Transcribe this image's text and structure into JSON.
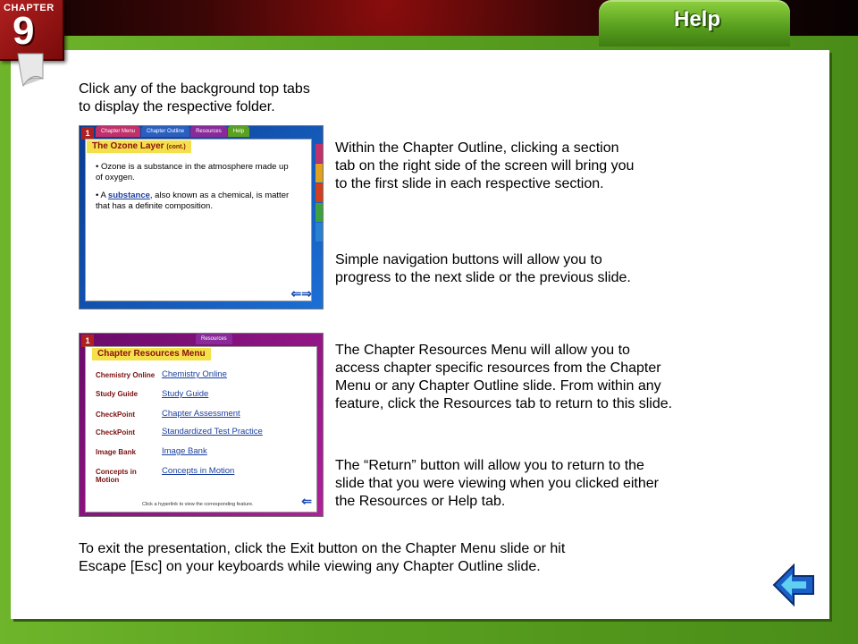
{
  "header": {
    "chapter_label": "CHAPTER",
    "chapter_number": "9",
    "active_tab": "Help"
  },
  "content": {
    "intro_text": "Click any of the background top tabs\nto display the respective folder.",
    "outline_text": "Within the Chapter Outline, clicking a section\ntab on the right side of the screen will bring you\nto the first slide in each respective section.",
    "nav_text": "Simple navigation buttons will allow you to\nprogress to the next slide or the previous slide.",
    "resources_text": "The Chapter Resources Menu will allow you to\naccess chapter specific resources from the Chapter\nMenu or any Chapter Outline slide. From within any\nfeature, click the Resources tab to return to this slide.",
    "return_text": "The “Return” button will allow you to return to the\nslide that you were viewing when you clicked either\nthe Resources or Help tab.",
    "exit_text": "To exit the presentation, click the Exit button on the Chapter Menu slide or hit\nEscape [Esc] on your keyboards while viewing any Chapter Outline slide."
  },
  "thumb_outline": {
    "badge": "1",
    "tabs": [
      "Chapter Menu",
      "Chapter Outline",
      "Resources",
      "Help"
    ],
    "title": "The Ozone Layer",
    "title_suffix": "(cont.)",
    "bullet1": "Ozone is a substance in the atmosphere made up of oxygen.",
    "bullet2_pre": "A ",
    "bullet2_link": "substance",
    "bullet2_post": ", also known as a chemical, is matter that has a definite composition."
  },
  "thumb_resources": {
    "badge": "1",
    "tab": "Resources",
    "title": "Chapter Resources Menu",
    "items": [
      {
        "logo": "Chemistry Online",
        "label": "Chemistry Online"
      },
      {
        "logo": "Study Guide",
        "label": "Study Guide"
      },
      {
        "logo": "CheckPoint",
        "label": "Chapter Assessment"
      },
      {
        "logo": "CheckPoint",
        "label": "Standardized Test Practice"
      },
      {
        "logo": "Image Bank",
        "label": "Image Bank"
      },
      {
        "logo": "Concepts in Motion",
        "label": "Concepts in Motion"
      }
    ],
    "caption": "Click a hyperlink to view the corresponding feature."
  },
  "colors": {
    "frame_green": "#5aa120",
    "tab_green": "#8fd13f",
    "chapter_red": "#b02020",
    "return_blue": "#1a5fc8"
  },
  "icons": {
    "return": "return-arrow-icon",
    "page_curl": "page-curl-icon"
  }
}
